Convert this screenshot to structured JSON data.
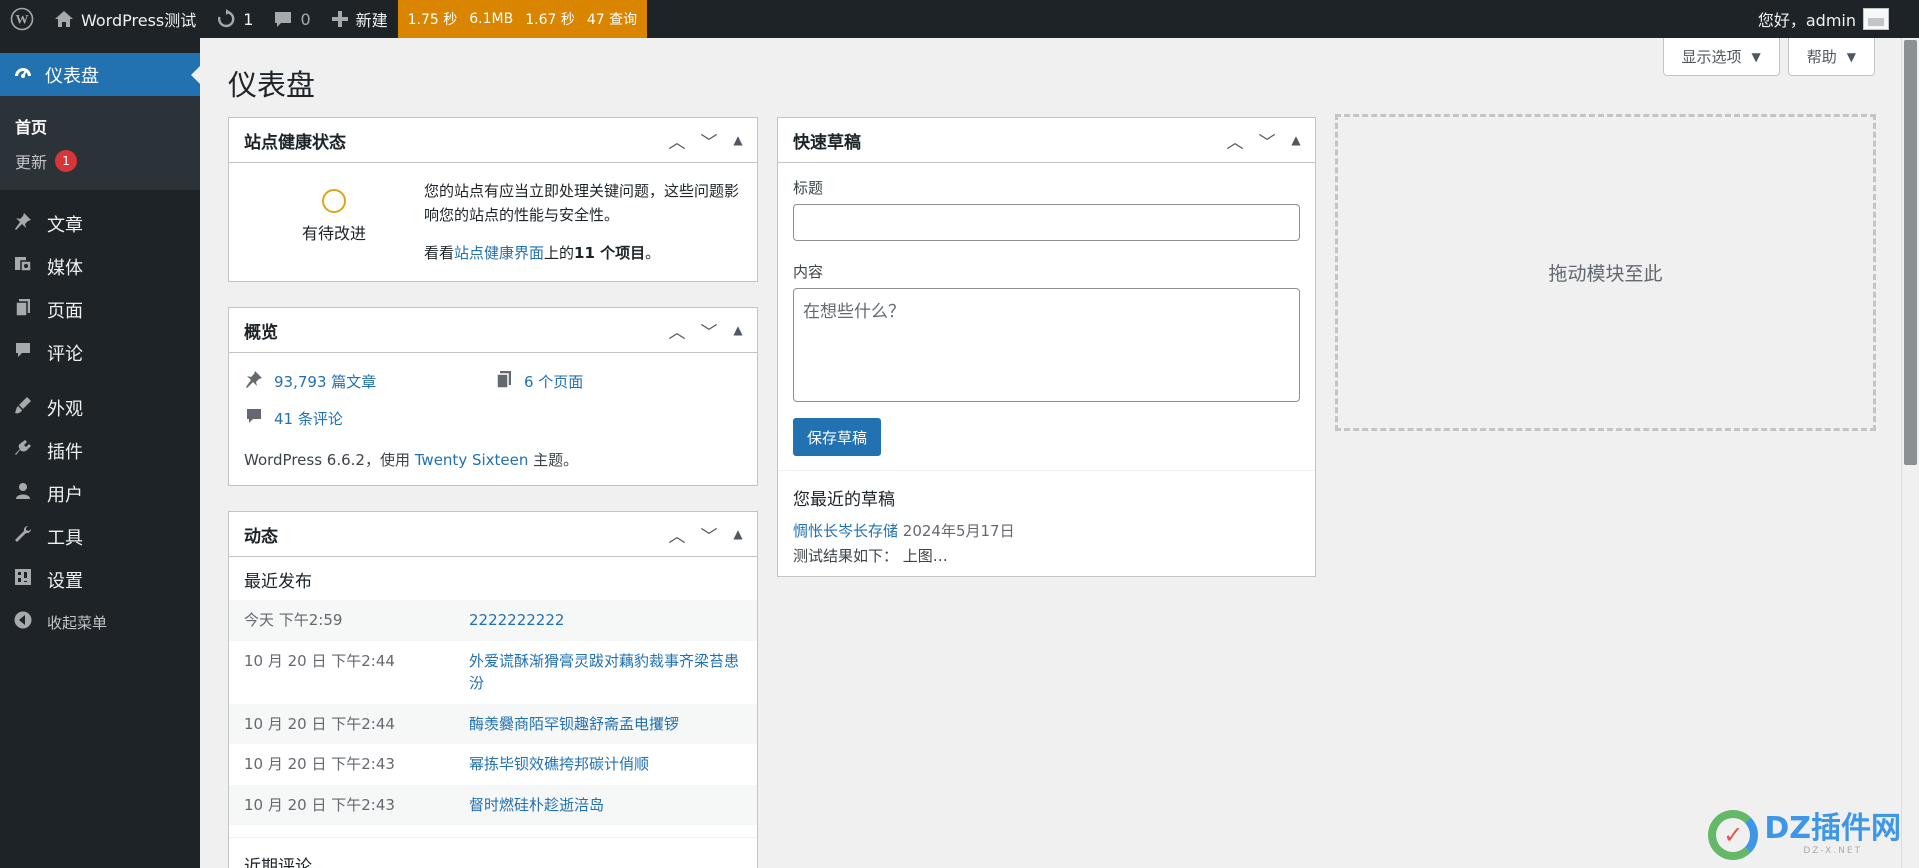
{
  "adminbar": {
    "site_name": "WordPress测试",
    "updates_count": "1",
    "comments_count": "0",
    "new_label": "新建",
    "perf": {
      "time": "1.75 秒",
      "memory": "6.1MB",
      "time2": "1.67 秒",
      "queries": "47 查询"
    },
    "greeting": "您好，admin"
  },
  "sidebar": {
    "current": "仪表盘",
    "submenu": [
      {
        "label": "首页"
      },
      {
        "label": "更新",
        "badge": "1"
      }
    ],
    "items": [
      {
        "label": "文章",
        "icon": "pin-icon"
      },
      {
        "label": "媒体",
        "icon": "media-icon"
      },
      {
        "label": "页面",
        "icon": "page-icon"
      },
      {
        "label": "评论",
        "icon": "comment-icon"
      },
      {
        "label": "外观",
        "icon": "appearance-icon"
      },
      {
        "label": "插件",
        "icon": "plugin-icon"
      },
      {
        "label": "用户",
        "icon": "user-icon"
      },
      {
        "label": "工具",
        "icon": "tools-icon"
      },
      {
        "label": "设置",
        "icon": "settings-icon"
      }
    ],
    "collapse": "收起菜单"
  },
  "main": {
    "title": "仪表盘",
    "screen_options": "显示选项",
    "help": "帮助"
  },
  "health": {
    "title": "站点健康状态",
    "status": "有待改进",
    "desc": "您的站点有应当立即处理关键问题，这些问题影响您的站点的性能与安全性。",
    "see_prefix": "看看",
    "see_link": "站点健康界面",
    "see_mid": "上的",
    "see_count": "11 个项目",
    "see_suffix": "。"
  },
  "glance": {
    "title": "概览",
    "posts": "93,793 篇文章",
    "pages": "6 个页面",
    "comments": "41 条评论",
    "footer_prefix": "WordPress 6.6.2，使用 ",
    "theme": "Twenty Sixteen",
    "footer_suffix": " 主题。"
  },
  "activity": {
    "title": "动态",
    "recent_published": "最近发布",
    "rows": [
      {
        "date": "今天 下午2:59",
        "title": "2222222222"
      },
      {
        "date": "10 月 20 日 下午2:44",
        "title": "外爱谎酥渐猾膏灵跋对藕豹裁事齐梁苔患汾"
      },
      {
        "date": "10 月 20 日 下午2:44",
        "title": "酶羡爨商陌罕钡趣舒斋孟电攫锣"
      },
      {
        "date": "10 月 20 日 下午2:43",
        "title": "幂拣毕钡效礁挎邦碳计俏顺"
      },
      {
        "date": "10 月 20 日 下午2:43",
        "title": "督时燃硅朴趁逝涪岛"
      }
    ],
    "recent_comments": "近期评论"
  },
  "quick_draft": {
    "title": "快速草稿",
    "title_label": "标题",
    "content_label": "内容",
    "content_placeholder": "在想些什么？",
    "save_button": "保存草稿",
    "recent_heading": "您最近的草稿",
    "draft_title": "惆怅长岑长存储",
    "draft_date": "2024年5月17日",
    "draft_excerpt": "测试结果如下：  上图…"
  },
  "drop_zone": {
    "label": "拖动模块至此"
  },
  "watermark": {
    "text": "DZ插件网",
    "sub": "DZ-X.NET"
  }
}
